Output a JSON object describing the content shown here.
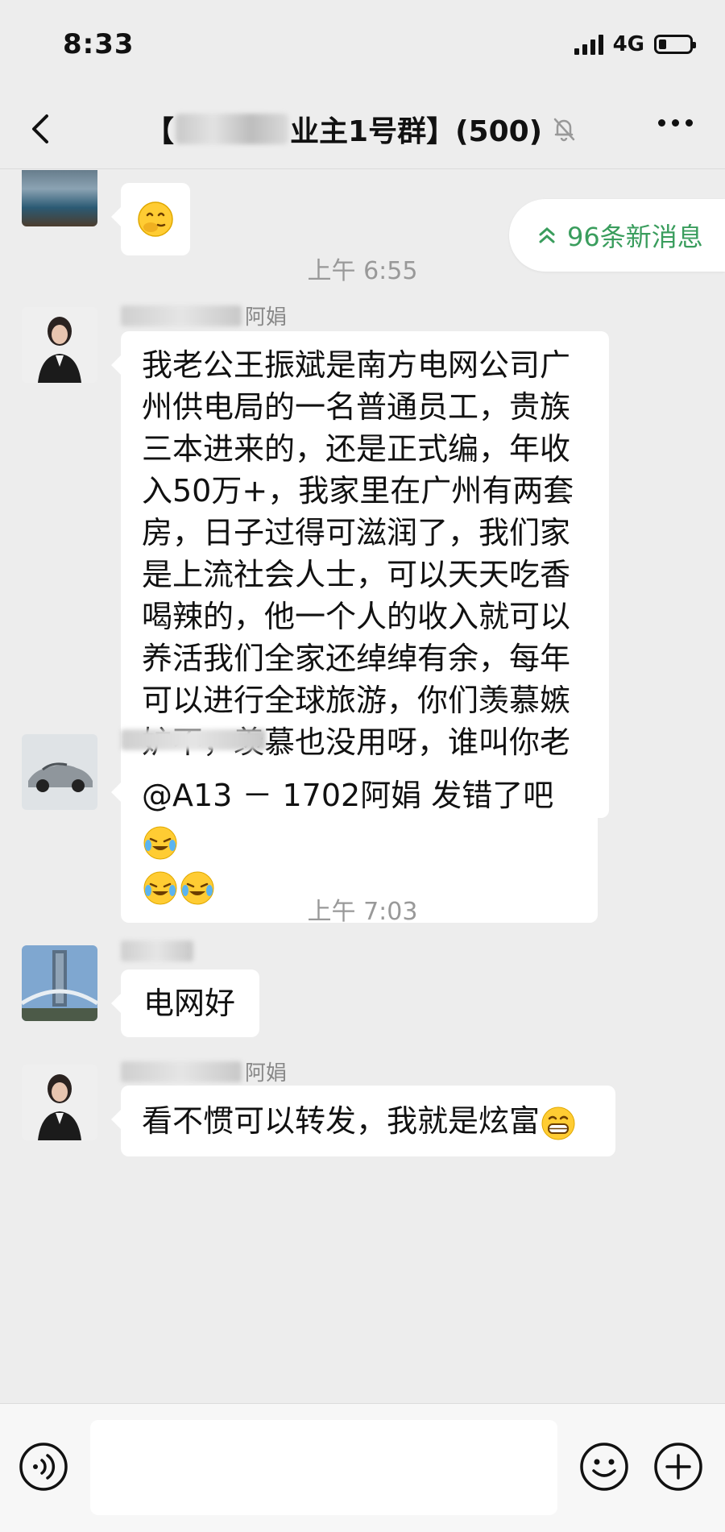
{
  "status_bar": {
    "time": "8:33",
    "network": "4G",
    "battery_level": 0.25
  },
  "nav": {
    "title_prefix": "【",
    "title_suffix": "业主1号群】(500)"
  },
  "new_messages_pill": "96条新消息",
  "messages": [
    {
      "sender_suffix": "阿娟",
      "text": "我老公王振斌是南方电网公司广州供电局的一名普通员工，贵族三本进来的，还是正式编，年收入50万+，我家里在广州有两套房，日子过得可滋润了，我们家是上流社会人士，可以天天吃香喝辣的，他一个人的收入就可以养活我们全家还绰绰有余，每年可以进行全球旅游，你们羡慕嫉妒不，羡慕也没用呀，谁叫你老公不是电网的呢，哈哈哈哈哈"
    },
    {
      "sender_suffix": "",
      "text": "@A13 － 1702阿娟 发错了吧"
    },
    {
      "sender_suffix": "",
      "text": "电网好"
    },
    {
      "sender_suffix": "阿娟",
      "text": "看不惯可以转发，我就是炫富"
    }
  ],
  "timestamps": [
    "上午 6:55",
    "上午 7:03"
  ],
  "icons": {
    "back": "chevron-left-icon",
    "mute": "bell-off-icon",
    "more": "more-icon",
    "voice": "voice-icon",
    "emoji": "emoji-icon",
    "plus": "plus-icon"
  }
}
